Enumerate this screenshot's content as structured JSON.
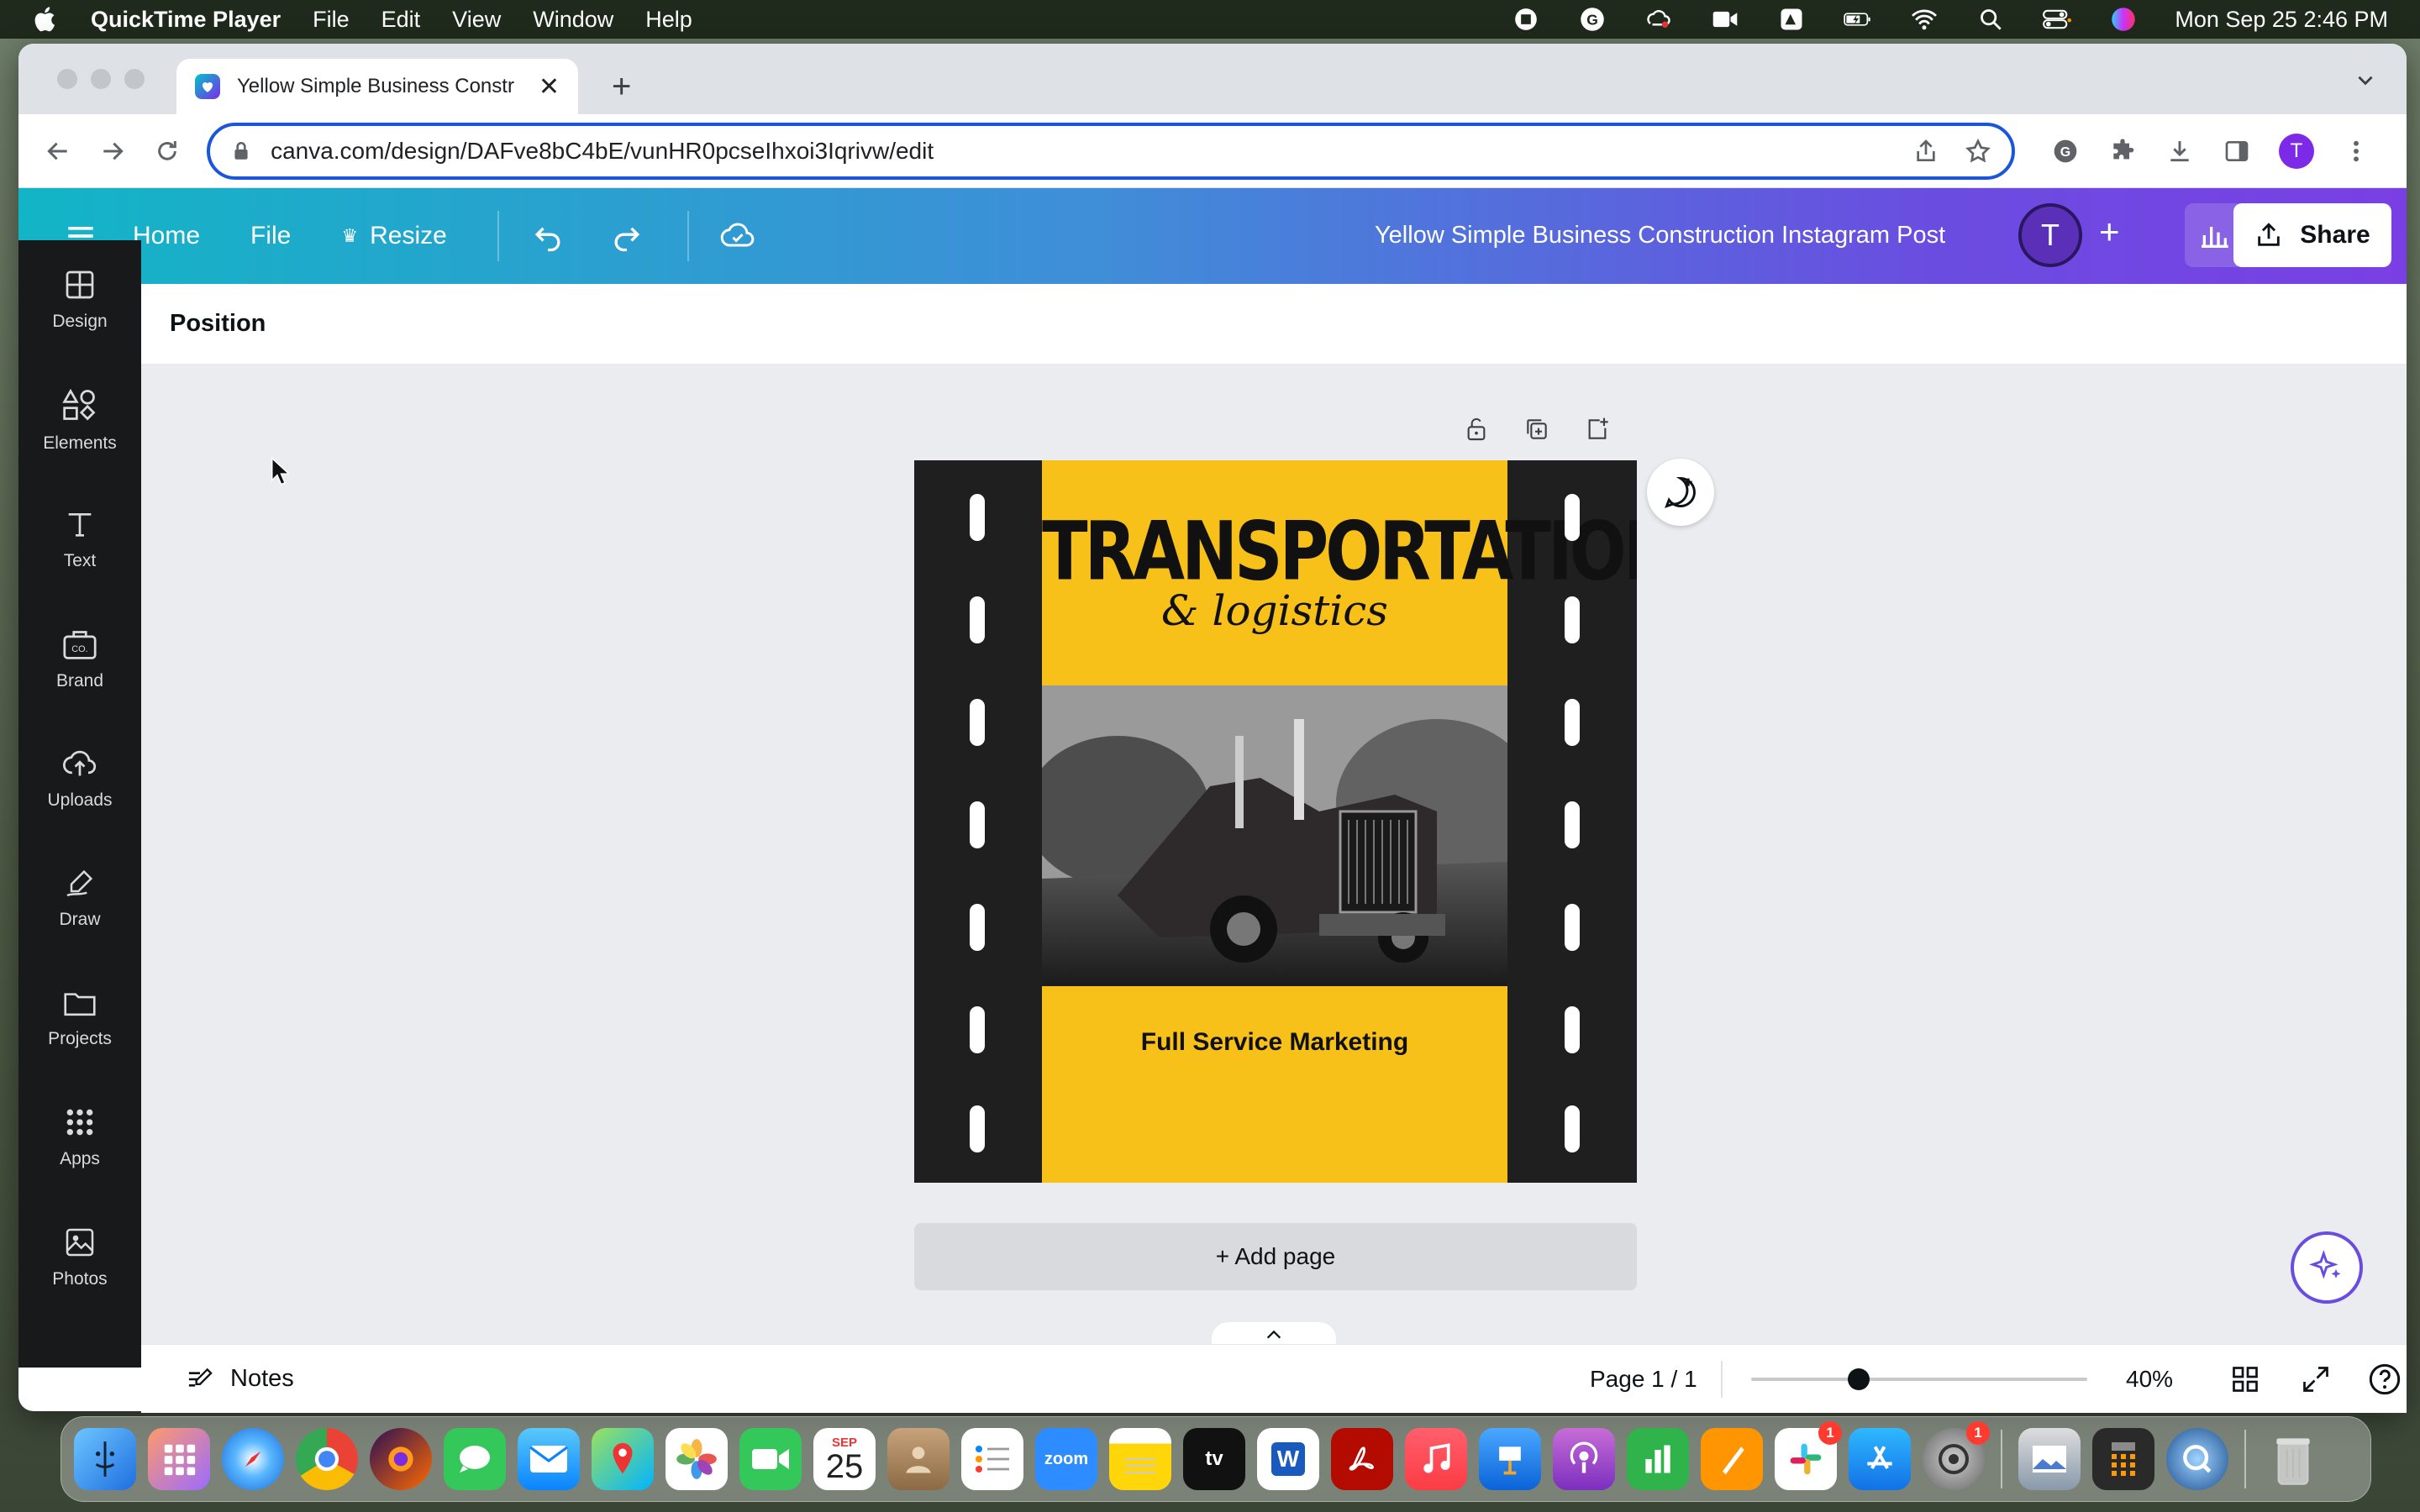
{
  "menubar": {
    "app_name": "QuickTime Player",
    "items": [
      "File",
      "Edit",
      "View",
      "Window",
      "Help"
    ],
    "clock": "Mon Sep 25  2:46 PM"
  },
  "browser": {
    "tab_title": "Yellow Simple Business Constr",
    "url": "canva.com/design/DAFve8bC4bE/vunHR0pcseIhxoi3Iqrivw/edit",
    "profile_initial": "T"
  },
  "canva": {
    "header": {
      "home_label": "Home",
      "file_label": "File",
      "resize_label": "Resize",
      "design_title": "Yellow Simple Business Construction Instagram Post",
      "avatar_initial": "T",
      "add_symbol": "+",
      "share_label": "Share"
    },
    "sidebar": {
      "items": [
        "Design",
        "Elements",
        "Text",
        "Brand",
        "Uploads",
        "Draw",
        "Projects",
        "Apps",
        "Photos"
      ]
    },
    "contextbar": {
      "label": "Position"
    },
    "design": {
      "headline": "TRANSPORTATION",
      "subline": "& logistics",
      "tagline": "Full Service Marketing"
    },
    "add_page_label": "+ Add page",
    "footer": {
      "notes_label": "Notes",
      "page_indicator": "Page 1 / 1",
      "zoom": "40%",
      "zoom_fraction": 0.32
    }
  },
  "dock": {
    "calendar_month": "SEP",
    "calendar_day": "25",
    "zoom_label": "zoom",
    "tv_label": "tv",
    "word_label": "W",
    "badges": {
      "slack": "1",
      "settings": "1"
    }
  },
  "colors": {
    "canva_gradient_start": "#12b5c6",
    "canva_gradient_end": "#7a3fe4",
    "design_yellow": "#f7c11a",
    "sidebar_dark": "#18191b"
  }
}
